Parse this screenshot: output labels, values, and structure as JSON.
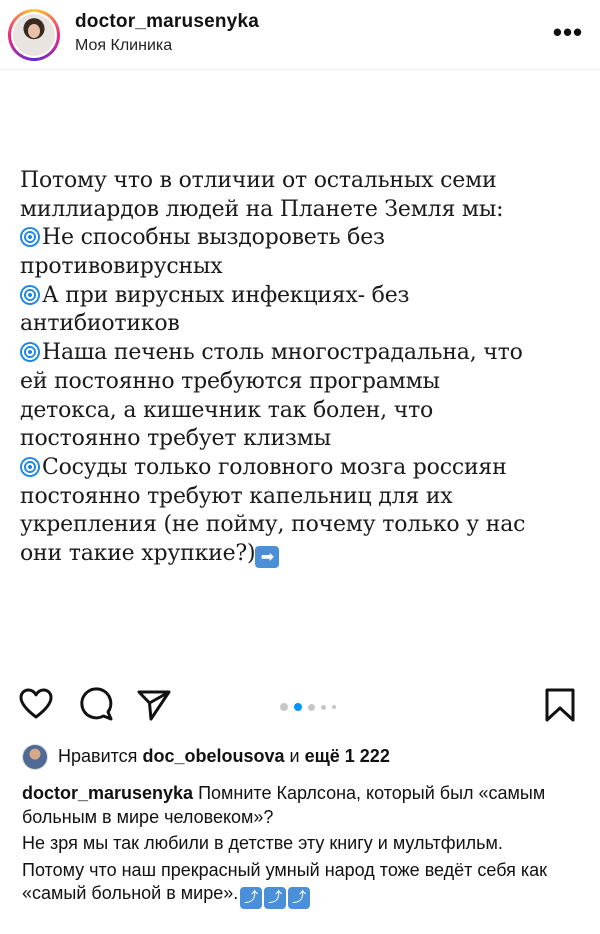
{
  "header": {
    "username": "doctor_marusenyka",
    "location": "Моя Клиника",
    "more_icon": "more-horizontal-icon",
    "more_label": "•••"
  },
  "slide": {
    "lines": [
      {
        "emoji": false,
        "text": "Потому что в отличии от остальных семи"
      },
      {
        "emoji": false,
        "text": "миллиардов людей на Планете Земля мы:"
      },
      {
        "emoji": true,
        "text": "Не способны выздороветь без"
      },
      {
        "emoji": false,
        "text": "противовирусных"
      },
      {
        "emoji": true,
        "text": "А при вирусных инфекциях- без"
      },
      {
        "emoji": false,
        "text": "антибиотиков"
      },
      {
        "emoji": true,
        "text": "Наша печень столь многострадальна, что"
      },
      {
        "emoji": false,
        "text": "ей постоянно требуются программы"
      },
      {
        "emoji": false,
        "text": "детокса, а кишечник так болен, что"
      },
      {
        "emoji": false,
        "text": "постоянно требует клизмы"
      },
      {
        "emoji": true,
        "text": "Сосуды только головного мозга россиян"
      },
      {
        "emoji": false,
        "text": "постоянно требуют капельниц для их"
      },
      {
        "emoji": false,
        "text": "укрепления (не пойму, почему только у нас"
      },
      {
        "emoji": false,
        "text": "они такие хрупкие?)"
      }
    ],
    "bullet_icon": "cyclone-emoji-icon",
    "end_icon": "right-arrow-emoji-icon",
    "end_glyph": "➡"
  },
  "carousel": {
    "slide_count": 5,
    "active_index": 1
  },
  "actions": {
    "like_icon": "heart-icon",
    "comment_icon": "comment-icon",
    "share_icon": "send-icon",
    "save_icon": "bookmark-icon"
  },
  "likes": {
    "prefix": "Нравится",
    "user": "doc_obelousova",
    "joiner": "и",
    "rest": "ещё 1 222"
  },
  "caption": {
    "author": "doctor_marusenyka",
    "paragraph1": "Помните Карлсона, который был «самым больным в мире человеком»?",
    "paragraph2": "Не зря мы так любили в детстве эту книгу и мультфильм.",
    "paragraph3": "Потому что наш прекрасный умный народ тоже ведёт себя как «самый больной в мире».",
    "end_emoji_icon": "up-right-arrow-emoji-icon",
    "end_emoji_glyph": "⤴",
    "end_emoji_count": 3
  },
  "colors": {
    "accent_blue": "#0095f6",
    "emoji_blue": "#4a90d9",
    "dot_inactive": "#c7c7c7"
  }
}
